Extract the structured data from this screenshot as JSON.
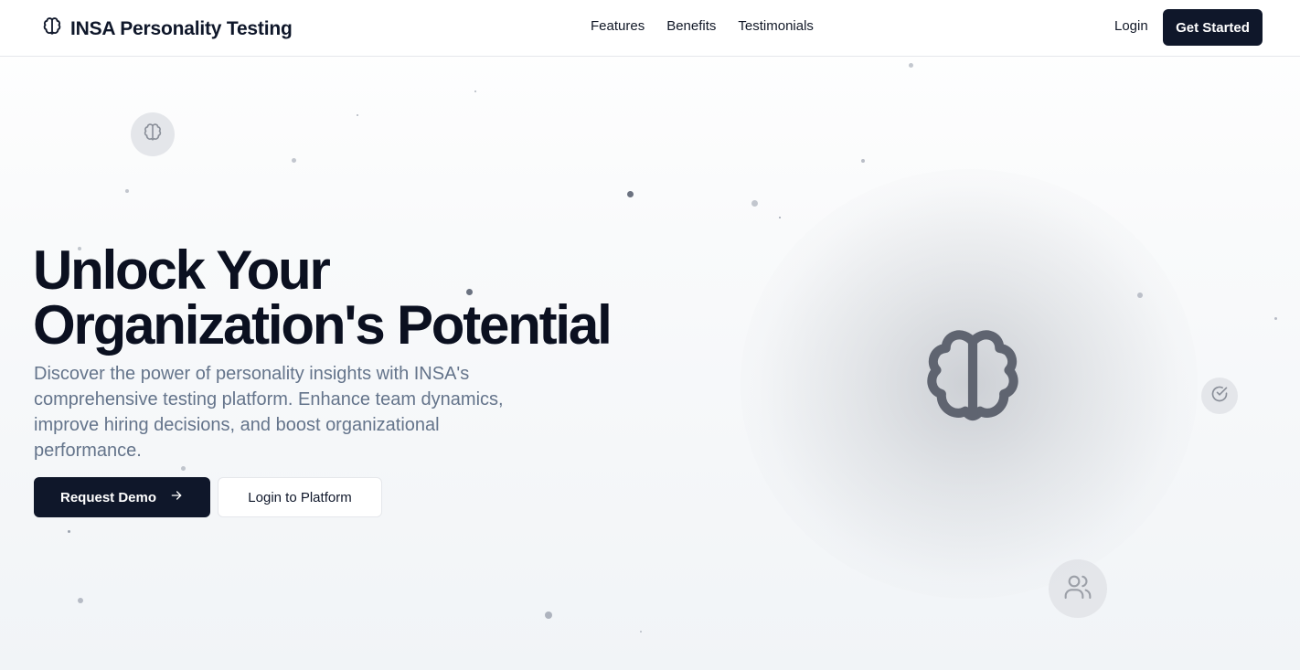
{
  "header": {
    "brand": "INSA Personality Testing",
    "nav": [
      "Features",
      "Benefits",
      "Testimonials"
    ],
    "login_label": "Login",
    "cta_label": "Get Started"
  },
  "hero": {
    "title_line1": "Unlock Your",
    "title_line2": "Organization's Potential",
    "subtitle": "Discover the power of personality insights with INSA's comprehensive testing platform. Enhance team dynamics, improve hiring decisions, and boost organizational performance.",
    "primary_button": "Request Demo",
    "secondary_button": "Login to Platform"
  },
  "illustration": {
    "main_icon": "brain-icon",
    "floating_icons": [
      "brain-icon",
      "check-circle-icon",
      "users-icon"
    ]
  },
  "colors": {
    "primary": "#0f172a",
    "muted_text": "#64748b",
    "icon_gray": "#5f6470"
  }
}
